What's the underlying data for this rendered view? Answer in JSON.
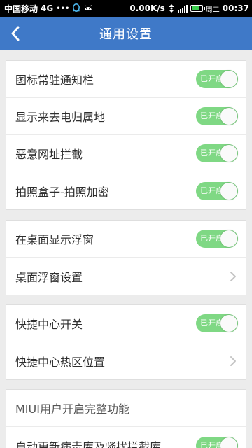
{
  "status_bar": {
    "carrier": "中国移动",
    "network": "4G",
    "dots": "•••",
    "speed": "0.00K/s",
    "day": "周二",
    "time": "00:37",
    "battery_level": 0.85,
    "icons": [
      "qq-icon",
      "android-icon",
      "data-transfer-icon",
      "signal-icon",
      "battery-icon"
    ]
  },
  "header": {
    "title": "通用设置",
    "back_icon": "chevron-left-icon"
  },
  "groups": [
    {
      "items": [
        {
          "label": "图标常驻通知栏",
          "control": "toggle",
          "state_label": "已开启",
          "on": true
        },
        {
          "label": "显示来去电归属地",
          "control": "toggle",
          "state_label": "已开启",
          "on": true
        },
        {
          "label": "恶意网址拦截",
          "control": "toggle",
          "state_label": "已开启",
          "on": true
        },
        {
          "label": "拍照盒子-拍照加密",
          "control": "toggle",
          "state_label": "已开启",
          "on": true
        }
      ]
    },
    {
      "items": [
        {
          "label": "在桌面显示浮窗",
          "control": "toggle",
          "state_label": "已开启",
          "on": true
        },
        {
          "label": "桌面浮窗设置",
          "control": "chevron"
        }
      ]
    },
    {
      "items": [
        {
          "label": "快捷中心开关",
          "control": "toggle",
          "state_label": "已开启",
          "on": true
        },
        {
          "label": "快捷中心热区位置",
          "control": "chevron"
        }
      ]
    },
    {
      "items": [
        {
          "label": "MIUI用户开启完整功能",
          "control": "none"
        },
        {
          "label": "自动更新病毒库及骚扰拦截库",
          "control": "toggle",
          "state_label": "已开启",
          "on": true
        }
      ]
    }
  ],
  "colors": {
    "header_bg": "#3f79c8",
    "toggle_on": "#7fd884",
    "page_bg": "#ececec",
    "chevron": "#c4c4c4"
  }
}
